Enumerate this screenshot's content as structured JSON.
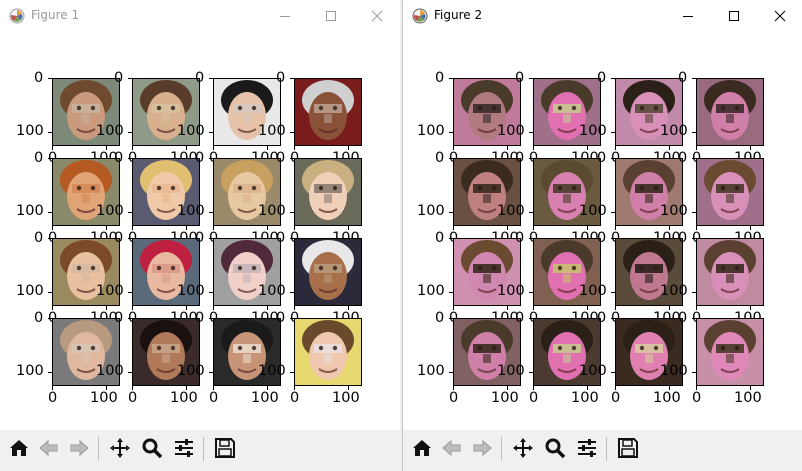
{
  "windows": [
    {
      "title": "Figure 1",
      "active": false
    },
    {
      "title": "Figure 2",
      "active": true
    }
  ],
  "window_controls": {
    "minimize_icon": "minimize-icon",
    "maximize_icon": "maximize-icon",
    "close_icon": "close-icon"
  },
  "axis_ticks": {
    "y0": "0",
    "y100": "100",
    "x0": "0",
    "x100": "100"
  },
  "toolbar": [
    {
      "name": "home-button",
      "icon": "home-icon"
    },
    {
      "name": "back-button",
      "icon": "back-arrow-icon"
    },
    {
      "name": "forward-button",
      "icon": "forward-arrow-icon"
    },
    {
      "name": "pan-button",
      "icon": "move-icon"
    },
    {
      "name": "zoom-button",
      "icon": "magnifier-icon"
    },
    {
      "name": "configure-subplots-button",
      "icon": "sliders-icon"
    },
    {
      "name": "save-button",
      "icon": "floppy-disk-icon"
    }
  ],
  "figure1_faces": [
    {
      "bg": "#7d8a7a",
      "skin": "#c99a7c",
      "hair": "#6f4a2e",
      "eye": "#c6b19c"
    },
    {
      "bg": "#8f9a88",
      "skin": "#d8b08d",
      "hair": "#5a3c2a",
      "eye": "#d7c29f"
    },
    {
      "bg": "#e8e8e8",
      "skin": "#e6c3a8",
      "hair": "#1a1a1a",
      "eye": "#d6c8c0"
    },
    {
      "bg": "#7a1c1c",
      "skin": "#8a5238",
      "hair": "#d0d0d0",
      "eye": "#b89c8c"
    },
    {
      "bg": "#8a8a6a",
      "skin": "#e0a477",
      "hair": "#b45a22",
      "eye": "#d58b55"
    },
    {
      "bg": "#5a5a70",
      "skin": "#f0c9a8",
      "hair": "#e0c070",
      "eye": "#e8b890"
    },
    {
      "bg": "#9a8a6a",
      "skin": "#e8c8a0",
      "hair": "#c8a060",
      "eye": "#d9b48e"
    },
    {
      "bg": "#6a6a5a",
      "skin": "#f0d0b8",
      "hair": "#c8b080",
      "eye": "#8a7a70"
    },
    {
      "bg": "#9a8a60",
      "skin": "#e9c0a0",
      "hair": "#7a4a2a",
      "eye": "#d6b9a2"
    },
    {
      "bg": "#5a6a7a",
      "skin": "#e9b8a0",
      "hair": "#c02040",
      "eye": "#d99a86"
    },
    {
      "bg": "#a0a0a0",
      "skin": "#f0d0c8",
      "hair": "#502a3a",
      "eye": "#c8b4b8"
    },
    {
      "bg": "#2a2a3a",
      "skin": "#a8704a",
      "hair": "#e8e8e8",
      "eye": "#b8987a"
    },
    {
      "bg": "#7a7a7a",
      "skin": "#e0b8a0",
      "hair": "#b89a80",
      "eye": "#d8c4b4"
    },
    {
      "bg": "#3a2a2a",
      "skin": "#b07a5a",
      "hair": "#1a1010",
      "eye": "#c8a48a"
    },
    {
      "bg": "#2a2a2a",
      "skin": "#c89478",
      "hair": "#1a1a1a",
      "eye": "#e8d8c8"
    },
    {
      "bg": "#e8d870",
      "skin": "#f0c8b0",
      "hair": "#6a4a2a",
      "eye": "#e8e0e0"
    }
  ],
  "figure2_faces": [
    {
      "bg": "#c07a9a",
      "skin": "#b07a80",
      "hair": "#4a3a2a",
      "eye": "#3a2a2a"
    },
    {
      "bg": "#a0708a",
      "skin": "#e070b0",
      "hair": "#4a3a2a",
      "eye": "#c8c890"
    },
    {
      "bg": "#c08aa8",
      "skin": "#d890b8",
      "hair": "#2a2018",
      "eye": "#5a4a3a"
    },
    {
      "bg": "#9a6a80",
      "skin": "#d080a8",
      "hair": "#3a2a20",
      "eye": "#3a2a2a"
    },
    {
      "bg": "#6a5040",
      "skin": "#c08080",
      "hair": "#3a2a20",
      "eye": "#3a2a20"
    },
    {
      "bg": "#6a5a40",
      "skin": "#d880b0",
      "hair": "#5a4a30",
      "eye": "#4a3a2a"
    },
    {
      "bg": "#a07a70",
      "skin": "#d080a8",
      "hair": "#5a4030",
      "eye": "#3a2a20"
    },
    {
      "bg": "#a0708a",
      "skin": "#d890b8",
      "hair": "#6a4a30",
      "eye": "#4a3a2a"
    },
    {
      "bg": "#d090b0",
      "skin": "#d088b0",
      "hair": "#6a4a30",
      "eye": "#3a2a20"
    },
    {
      "bg": "#806050",
      "skin": "#e070b0",
      "hair": "#4a3a2a",
      "eye": "#c8c070"
    },
    {
      "bg": "#5a4a3a",
      "skin": "#c07890",
      "hair": "#2a2018",
      "eye": "#2a2018"
    },
    {
      "bg": "#c08aa0",
      "skin": "#d890b8",
      "hair": "#5a4030",
      "eye": "#3a2a20"
    },
    {
      "bg": "#806060",
      "skin": "#d080a8",
      "hair": "#4a3a2a",
      "eye": "#3a2a20"
    },
    {
      "bg": "#4a3a30",
      "skin": "#e070b0",
      "hair": "#2a2018",
      "eye": "#c8c890"
    },
    {
      "bg": "#3a2a20",
      "skin": "#e080b0",
      "hair": "#2a2018",
      "eye": "#d8c8a0"
    },
    {
      "bg": "#c890a8",
      "skin": "#e088b8",
      "hair": "#5a4030",
      "eye": "#4a3a2a"
    }
  ]
}
